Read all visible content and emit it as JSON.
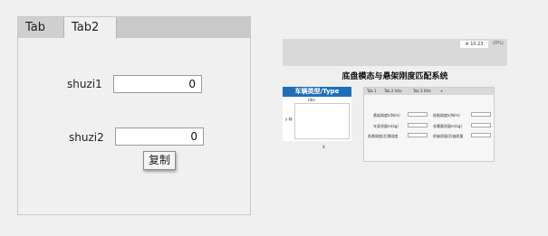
{
  "tabs": [
    {
      "label": "Tab"
    },
    {
      "label": "Tab2"
    }
  ],
  "form": {
    "fields": [
      {
        "label": "shuzi1",
        "value": "0"
      },
      {
        "label": "shuzi2",
        "value": "0"
      }
    ],
    "copy_button": "复制"
  },
  "thumbnail": {
    "header_badge": "※ 10.23",
    "header_user": "(0%)",
    "title": "底盘模态与悬架刚度匹配系统",
    "left_header": "车辆类型/Type",
    "plot_title": "title",
    "y_label": "y 轴",
    "x_label": "X",
    "tabs": [
      "Tab 1",
      "Tab 2 title",
      "Tab 3 title",
      "+"
    ],
    "rows": [
      {
        "left": "悬架刚度k(N/m)",
        "right": "轮胎刚度k(N/m)"
      },
      {
        "left": "车身质量m(kg)",
        "right": "非簧载质量m(kg)"
      },
      {
        "left": "前悬刚度/后悬刚度",
        "right": "前轴质量/后轴质量"
      }
    ]
  }
}
